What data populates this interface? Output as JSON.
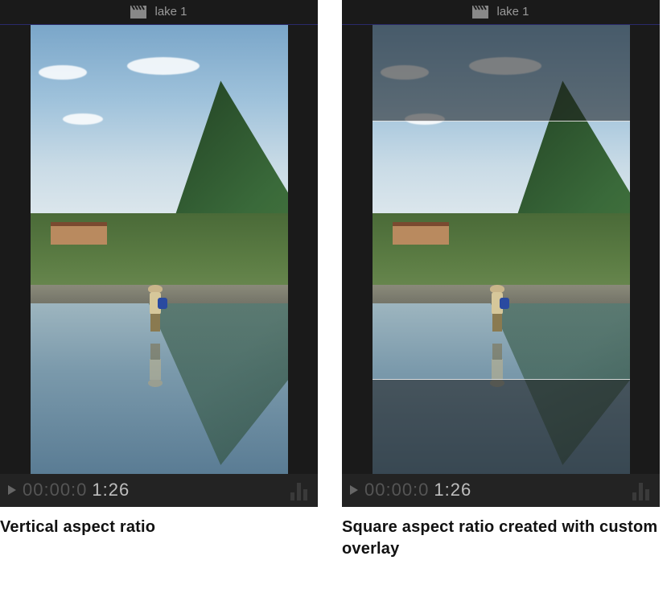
{
  "panels": [
    {
      "title": "lake 1",
      "timecode_dim": "00:00:0",
      "timecode_bright": "1:26",
      "caption": "Vertical aspect ratio",
      "has_overlay": false
    },
    {
      "title": "lake 1",
      "timecode_dim": "00:00:0",
      "timecode_bright": "1:26",
      "caption": "Square aspect ratio created with custom overlay",
      "has_overlay": true
    }
  ],
  "icons": {
    "clapper": "clapperboard-icon",
    "play": "play-icon"
  }
}
